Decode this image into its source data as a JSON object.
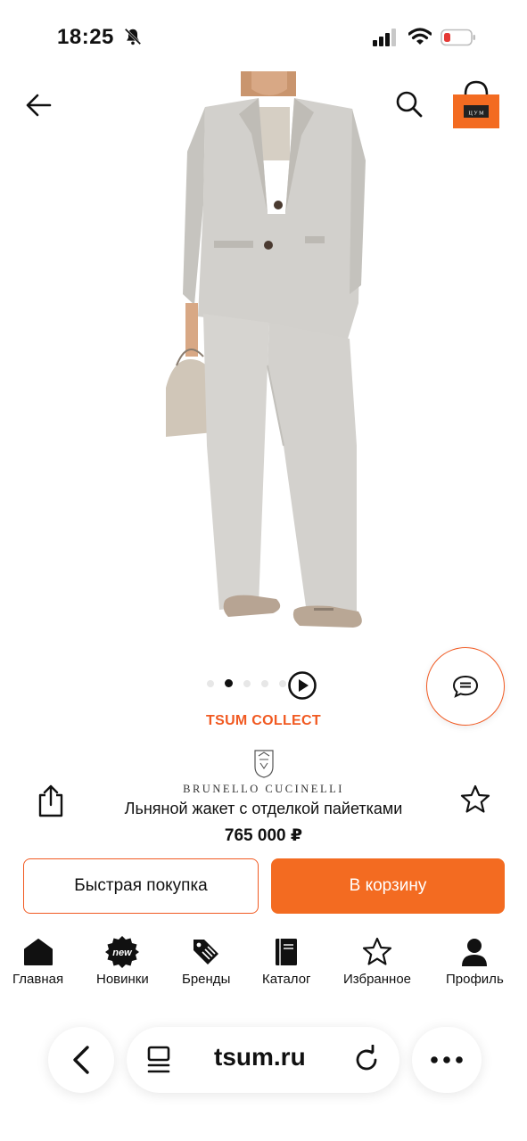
{
  "status_bar": {
    "time": "18:25",
    "battery_color": "#e53935"
  },
  "colors": {
    "accent": "#f15a22",
    "accent_fill": "#f36b21"
  },
  "header": {
    "cart_badge_text": "Ц У М"
  },
  "product": {
    "image_alt_icon": "product-photo",
    "image_count": 5,
    "active_image_index": 1,
    "collection_label": "TSUM COLLECT",
    "brand": "BRUNELLO CUCINELLI",
    "title": "Льняной жакет с отделкой пайетками",
    "price": "765 000 ₽"
  },
  "actions": {
    "quick_buy_label": "Быстрая покупка",
    "add_to_cart_label": "В корзину"
  },
  "tabs": [
    {
      "label": "Главная",
      "icon": "home-icon"
    },
    {
      "label": "Новинки",
      "icon": "new-badge-icon",
      "badge": "new"
    },
    {
      "label": "Бренды",
      "icon": "tag-icon"
    },
    {
      "label": "Каталог",
      "icon": "catalog-book-icon"
    },
    {
      "label": "Избранное",
      "icon": "star-icon"
    },
    {
      "label": "Профиль",
      "icon": "user-icon"
    }
  ],
  "browser": {
    "url": "tsum.ru"
  }
}
